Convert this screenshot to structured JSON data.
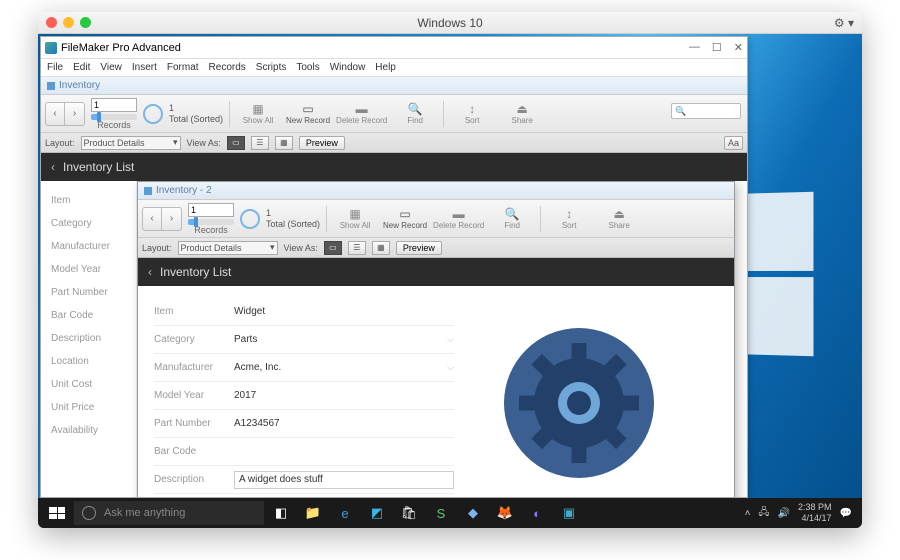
{
  "mac": {
    "title": "Windows 10"
  },
  "app": {
    "title": "FileMaker Pro Advanced",
    "menus": [
      "File",
      "Edit",
      "View",
      "Insert",
      "Format",
      "Records",
      "Scripts",
      "Tools",
      "Window",
      "Help"
    ],
    "tab1": "Inventory",
    "tab2": "Inventory - 2"
  },
  "toolbar": {
    "record_current": "1",
    "records_label": "Records",
    "total_count": "1",
    "total_label": "Total (Sorted)",
    "show_all": "Show All",
    "new_record": "New Record",
    "delete_record": "Delete Record",
    "find": "Find",
    "sort": "Sort",
    "share": "Share"
  },
  "layoutbar": {
    "layout_label": "Layout:",
    "layout_value": "Product Details",
    "viewas_label": "View As:",
    "preview": "Preview",
    "aa": "Aa"
  },
  "header": {
    "title": "Inventory List"
  },
  "sidebar": {
    "items": [
      "Item",
      "Category",
      "Manufacturer",
      "Model Year",
      "Part Number",
      "Bar Code",
      "Description",
      "Location",
      "Unit Cost",
      "Unit Price",
      "Availability"
    ]
  },
  "details": {
    "item_label": "Item",
    "item_value": "Widget",
    "category_label": "Category",
    "category_value": "Parts",
    "manufacturer_label": "Manufacturer",
    "manufacturer_value": "Acme, Inc.",
    "modelyear_label": "Model Year",
    "modelyear_value": "2017",
    "partnumber_label": "Part Number",
    "partnumber_value": "A1234567",
    "barcode_label": "Bar Code",
    "barcode_value": "",
    "description_label": "Description",
    "description_value": "A widget does stuff"
  },
  "taskbar": {
    "cortana_placeholder": "Ask me anything",
    "time": "2:38 PM",
    "date": "4/14/17"
  }
}
